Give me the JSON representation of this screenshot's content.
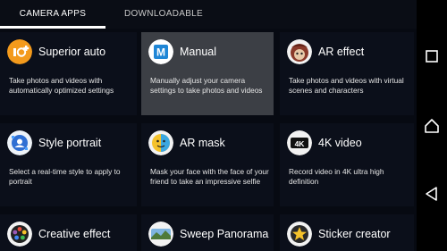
{
  "tabs": [
    {
      "label": "CAMERA APPS",
      "active": true
    },
    {
      "label": "DOWNLOADABLE",
      "active": false
    }
  ],
  "apps": [
    {
      "name": "Superior auto",
      "description": "Take photos and videos with automatically optimized settings",
      "icon": "superior-auto-icon"
    },
    {
      "name": "Manual",
      "description": "Manually adjust your camera settings to take photos and videos",
      "icon": "manual-mode-icon",
      "selected": true
    },
    {
      "name": "AR effect",
      "description": "Take photos and videos with virtual scenes and characters",
      "icon": "ar-effect-icon"
    },
    {
      "name": "Style portrait",
      "description": "Select a real-time style to apply to portrait",
      "icon": "style-portrait-icon"
    },
    {
      "name": "AR mask",
      "description": "Mask your face with the face of your friend to take an impressive selfie",
      "icon": "ar-mask-icon"
    },
    {
      "name": "4K video",
      "description": "Record video in 4K ultra high definition",
      "icon": "4k-video-icon"
    },
    {
      "name": "Creative effect",
      "description": "",
      "icon": "creative-effect-icon"
    },
    {
      "name": "Sweep Panorama",
      "description": "",
      "icon": "sweep-panorama-icon"
    },
    {
      "name": "Sticker creator",
      "description": "",
      "icon": "sticker-creator-icon"
    }
  ],
  "icon_text": {
    "manual": "M",
    "four_k": "4K"
  },
  "navigation": [
    "square-icon",
    "home-icon",
    "back-icon"
  ],
  "colors": {
    "background": "#070a12",
    "card": "#0b0f1a",
    "selected_card": "#3c3f45",
    "superior_orange": "#f39a1c",
    "manual_blue": "#1f86d6"
  }
}
